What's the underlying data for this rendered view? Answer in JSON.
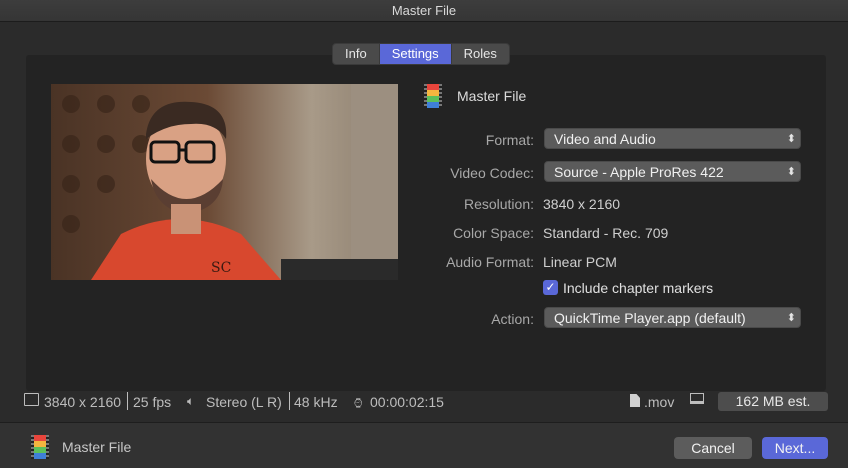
{
  "window": {
    "title": "Master File"
  },
  "tabs": [
    {
      "label": "Info"
    },
    {
      "label": "Settings"
    },
    {
      "label": "Roles"
    }
  ],
  "header": {
    "name": "Master File",
    "icon": "film-strip-icon"
  },
  "settings": {
    "format_label": "Format:",
    "format_value": "Video and Audio",
    "codec_label": "Video Codec:",
    "codec_value": "Source - Apple ProRes 422",
    "resolution_label": "Resolution:",
    "resolution_value": "3840 x 2160",
    "colorspace_label": "Color Space:",
    "colorspace_value": "Standard - Rec. 709",
    "audioformat_label": "Audio Format:",
    "audioformat_value": "Linear PCM",
    "chapter_label": "Include chapter markers",
    "chapter_checked": true,
    "action_label": "Action:",
    "action_value": "QuickTime Player.app (default)"
  },
  "status": {
    "resolution": "3840 x 2160",
    "fps": "25 fps",
    "audio": "Stereo (L R)",
    "sample_rate": "48 kHz",
    "duration": "00:00:02:15",
    "extension": ".mov",
    "size": "162 MB est."
  },
  "footer": {
    "name": "Master File",
    "cancel_label": "Cancel",
    "next_label": "Next..."
  },
  "colors": {
    "accent": "#5a68d8",
    "background": "#2b2b2b"
  }
}
